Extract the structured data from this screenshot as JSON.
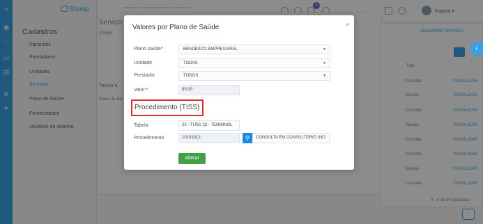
{
  "app": {
    "logo_text": "Shosp"
  },
  "sidebar": {
    "title": "Cadastros",
    "items": [
      {
        "label": "Pacientes"
      },
      {
        "label": "Prestadores"
      },
      {
        "label": "Unidades"
      },
      {
        "label": "Serviços"
      },
      {
        "label": "Plano de Saúde"
      },
      {
        "label": "Fornecedores"
      },
      {
        "label": "Usuários do sistema"
      }
    ]
  },
  "header": {
    "user_name": "Karyna",
    "notification_count": "4"
  },
  "background": {
    "page_title": "Serviço",
    "code_label": "Código",
    "add_service": "ADICIONAR SERVIÇO",
    "table_title": "Tabela d",
    "col_plan": "Plano de Sa",
    "col_type": "Tipo",
    "rows": [
      {
        "type": "Consulta",
        "action": "VISUALIZAR"
      },
      {
        "type": "Sessão",
        "action": "VISUALIZAR"
      },
      {
        "type": "Consulta",
        "action": "VISUALIZAR"
      },
      {
        "type": "Sessão",
        "action": "VISUALIZAR"
      },
      {
        "type": "Consulta",
        "action": "VISUALIZAR"
      },
      {
        "type": "Consulta",
        "action": "VISUALIZAR"
      },
      {
        "type": "Sessão",
        "action": "VISUALIZAR"
      },
      {
        "type": "Consulta",
        "action": "VISUALIZAR"
      }
    ],
    "pagination": "0 - 8 de 30 cadastros"
  },
  "modal": {
    "title": "Valores por Plano de Saúde",
    "plano_label": "Plano saúde*",
    "plano_value": "BRADESCO EMPRESARIAL",
    "unidade_label": "Unidade",
    "unidade_value": "TODAS",
    "prestador_label": "Prestador",
    "prestador_value": "TODOS",
    "valor_label": "Valor:*",
    "valor_value": "85,00",
    "section_title": "Procedimento (TISS)",
    "tabela_label": "Tabela",
    "tabela_value": "22 - TUSS 22 - TERMINOL",
    "procedimento_label": "Procedimento",
    "procedimento_value": "10101012",
    "procedimento_desc": "CONSULTA EM CONSULTÓRIO (NO",
    "submit_label": "Alterar"
  },
  "colors": {
    "accent": "#3aa0e3",
    "success": "#43a047",
    "highlight": "#e12a2a"
  }
}
